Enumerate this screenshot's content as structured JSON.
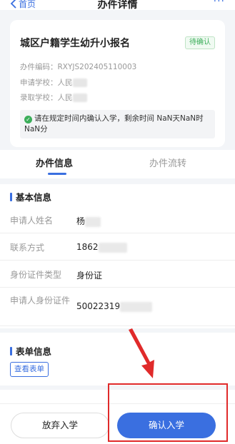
{
  "header": {
    "back_label": "首页",
    "title": "办件详情",
    "more_label": "···"
  },
  "card": {
    "title": "城区户籍学生幼升小报名",
    "status_badge": "待确认",
    "case_no_label": "办件编码：",
    "case_no_value": "RXYJS202405110003",
    "applying_school_label": "申请学校：",
    "applying_school_value": "人民",
    "admitted_school_label": "录取学校：",
    "admitted_school_value": "人民",
    "notice": "请在规定时间内确认入学，剩余时间 NaN天NaN时NaN分"
  },
  "tabs": [
    {
      "label": "办件信息",
      "active": true
    },
    {
      "label": "办件流转",
      "active": false
    }
  ],
  "basic_info": {
    "heading": "基本信息",
    "fields": [
      {
        "label": "申请人姓名",
        "value": "杨"
      },
      {
        "label": "联系方式",
        "value": "1862"
      },
      {
        "label": "身份证件类型",
        "value": "身份证"
      },
      {
        "label": "申请人身份证件",
        "value": "50022319"
      }
    ]
  },
  "form_info": {
    "heading": "表单信息",
    "view_button": "查看表单"
  },
  "actions": {
    "abandon": "放弃入学",
    "confirm": "确认入学"
  },
  "colors": {
    "accent": "#3a6fe0",
    "status_green": "#3cae5a",
    "annotation_red": "#e02a2a"
  }
}
